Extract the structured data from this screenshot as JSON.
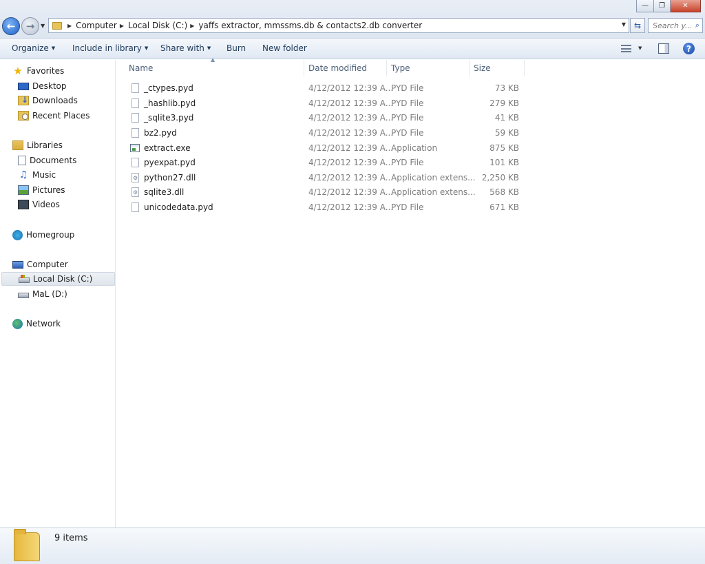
{
  "window": {
    "minimize_glyph": "—",
    "maximize_glyph": "❐",
    "close_glyph": "✕"
  },
  "address_bar": {
    "breadcrumbs": [
      "Computer",
      "Local Disk (C:)",
      "yaffs extractor, mmssms.db & contacts2.db converter"
    ],
    "search_placeholder": "Search y..."
  },
  "toolbar": {
    "organize": "Organize",
    "include_in_library": "Include in library",
    "share_with": "Share with",
    "burn": "Burn",
    "new_folder": "New folder"
  },
  "nav": {
    "favorites": "Favorites",
    "desktop": "Desktop",
    "downloads": "Downloads",
    "recent_places": "Recent Places",
    "libraries": "Libraries",
    "documents": "Documents",
    "music": "Music",
    "pictures": "Pictures",
    "videos": "Videos",
    "homegroup": "Homegroup",
    "computer": "Computer",
    "local_disk": "Local Disk (C:)",
    "mal_drive": "MaL (D:)",
    "network": "Network"
  },
  "columns": {
    "name": "Name",
    "date_modified": "Date modified",
    "type": "Type",
    "size": "Size"
  },
  "files": [
    {
      "name": "_ctypes.pyd",
      "date": "4/12/2012 12:39 A...",
      "type": "PYD File",
      "size": "73 KB",
      "icon": "file"
    },
    {
      "name": "_hashlib.pyd",
      "date": "4/12/2012 12:39 A...",
      "type": "PYD File",
      "size": "279 KB",
      "icon": "file"
    },
    {
      "name": "_sqlite3.pyd",
      "date": "4/12/2012 12:39 A...",
      "type": "PYD File",
      "size": "41 KB",
      "icon": "file"
    },
    {
      "name": "bz2.pyd",
      "date": "4/12/2012 12:39 A...",
      "type": "PYD File",
      "size": "59 KB",
      "icon": "file"
    },
    {
      "name": "extract.exe",
      "date": "4/12/2012 12:39 A...",
      "type": "Application",
      "size": "875 KB",
      "icon": "exe"
    },
    {
      "name": "pyexpat.pyd",
      "date": "4/12/2012 12:39 A...",
      "type": "PYD File",
      "size": "101 KB",
      "icon": "file"
    },
    {
      "name": "python27.dll",
      "date": "4/12/2012 12:39 A...",
      "type": "Application extens...",
      "size": "2,250 KB",
      "icon": "dll"
    },
    {
      "name": "sqlite3.dll",
      "date": "4/12/2012 12:39 A...",
      "type": "Application extens...",
      "size": "568 KB",
      "icon": "dll"
    },
    {
      "name": "unicodedata.pyd",
      "date": "4/12/2012 12:39 A...",
      "type": "PYD File",
      "size": "671 KB",
      "icon": "file"
    }
  ],
  "status": {
    "items_count": "9 items"
  }
}
